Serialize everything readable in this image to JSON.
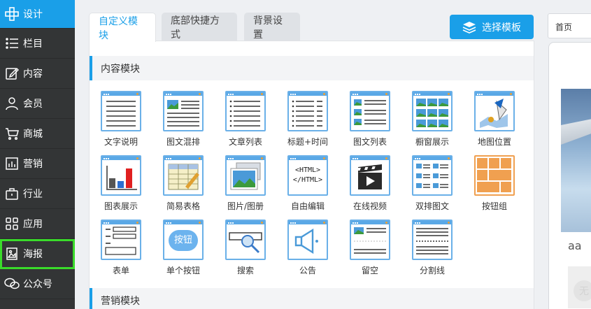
{
  "sidebar": {
    "items": [
      {
        "label": "设计",
        "icon": "design-icon"
      },
      {
        "label": "栏目",
        "icon": "list-icon"
      },
      {
        "label": "内容",
        "icon": "edit-icon"
      },
      {
        "label": "会员",
        "icon": "user-icon"
      },
      {
        "label": "商城",
        "icon": "cart-icon"
      },
      {
        "label": "营销",
        "icon": "chart-icon"
      },
      {
        "label": "行业",
        "icon": "briefcase-icon"
      },
      {
        "label": "应用",
        "icon": "apps-icon"
      },
      {
        "label": "海报",
        "icon": "poster-icon"
      },
      {
        "label": "公众号",
        "icon": "wechat-icon"
      }
    ]
  },
  "tabs": [
    {
      "label": "自定义模块"
    },
    {
      "label": "底部快捷方式"
    },
    {
      "label": "背景设置"
    }
  ],
  "template_button": "选择模板",
  "sections": {
    "content": "内容模块",
    "marketing": "营销模块"
  },
  "modules": [
    {
      "label": "文字说明",
      "icon": "text-doc-icon"
    },
    {
      "label": "图文混排",
      "icon": "image-text-icon"
    },
    {
      "label": "文章列表",
      "icon": "article-list-icon"
    },
    {
      "label": "标题+时间",
      "icon": "title-time-icon"
    },
    {
      "label": "图文列表",
      "icon": "image-list-icon"
    },
    {
      "label": "橱窗展示",
      "icon": "showcase-icon"
    },
    {
      "label": "地图位置",
      "icon": "map-icon"
    },
    {
      "label": "图表展示",
      "icon": "bar-chart-icon"
    },
    {
      "label": "简易表格",
      "icon": "table-icon"
    },
    {
      "label": "图片/图册",
      "icon": "gallery-icon"
    },
    {
      "label": "自由编辑",
      "icon": "html-icon",
      "html_top": "<HTML>",
      "html_bottom": "</HTML>"
    },
    {
      "label": "在线视频",
      "icon": "video-icon"
    },
    {
      "label": "双排图文",
      "icon": "double-column-icon"
    },
    {
      "label": "按钮组",
      "icon": "button-group-icon"
    },
    {
      "label": "表单",
      "icon": "form-icon"
    },
    {
      "label": "单个按钮",
      "icon": "single-button-icon",
      "button_text": "按钮"
    },
    {
      "label": "搜索",
      "icon": "search-icon"
    },
    {
      "label": "公告",
      "icon": "announcement-icon"
    },
    {
      "label": "留空",
      "icon": "blank-icon"
    },
    {
      "label": "分割线",
      "icon": "divider-icon"
    }
  ],
  "preview": {
    "page_select": "首页",
    "caption": "aa",
    "thumb_text": "无"
  },
  "colors": {
    "accent": "#1a9fe8",
    "sidebar_bg": "#333536",
    "highlight": "#3adb2a"
  }
}
